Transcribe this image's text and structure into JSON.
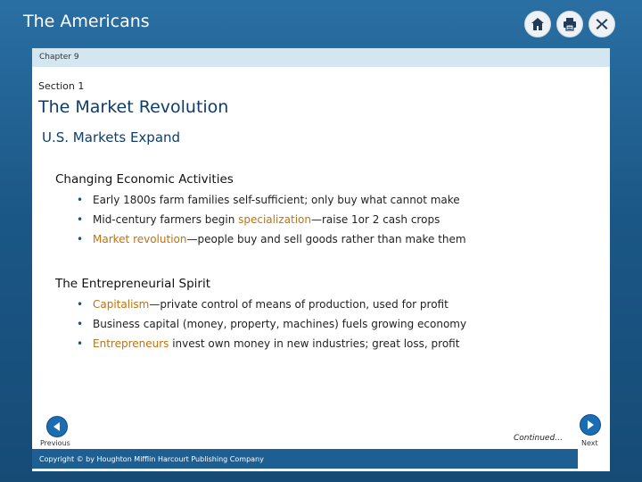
{
  "app": {
    "title": "The Americans"
  },
  "toolbar": {
    "home_icon": "home-icon",
    "print_icon": "print-icon",
    "close_icon": "close-icon"
  },
  "slide": {
    "chapter": "Chapter 9",
    "section": "Section 1",
    "title": "The Market Revolution",
    "subtitle": "U.S. Markets Expand",
    "groups": [
      {
        "heading": "Changing Economic Activities",
        "bullets": [
          {
            "before": "Early 1800s farm families self-sufficient; only buy what cannot make",
            "term": "",
            "after": ""
          },
          {
            "before": "Mid-century farmers begin ",
            "term": "specialization",
            "after": "—raise 1or 2 cash crops"
          },
          {
            "before": "",
            "term": "Market revolution",
            "after": "—people buy and sell goods rather than make them"
          }
        ]
      },
      {
        "heading": "The Entrepreneurial Spirit",
        "bullets": [
          {
            "before": "",
            "term": "Capitalism",
            "after": "—private control of means of production, used for profit"
          },
          {
            "before": "Business capital (money, property, machines) fuels growing economy",
            "term": "",
            "after": ""
          },
          {
            "before": "",
            "term": "Entrepreneurs",
            "after": " invest own money in new industries; great loss, profit"
          }
        ]
      }
    ]
  },
  "navigation": {
    "previous_label": "Previous",
    "next_label": "Next",
    "continued_label": "Continued…"
  },
  "footer": {
    "copyright": "Copyright © by Houghton Mifflin Harcourt Publishing Company"
  },
  "colors": {
    "background": "#1f5f8f",
    "title_blue": "#0e3d6b",
    "term_orange": "#c0720b",
    "chapter_bar": "#d4e7f1"
  }
}
